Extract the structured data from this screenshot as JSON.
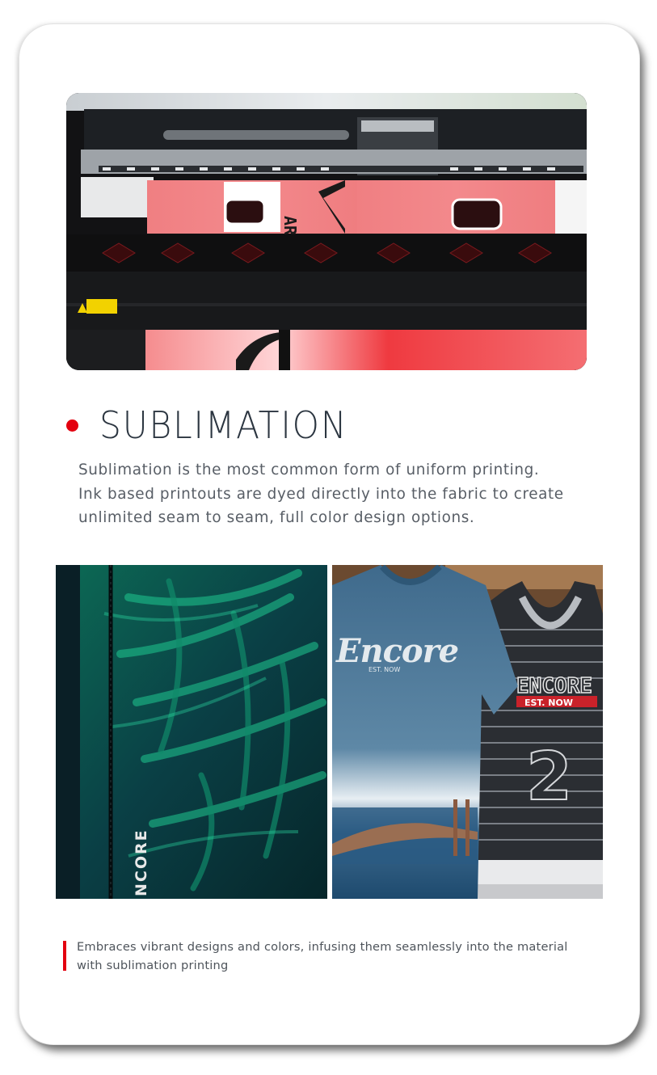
{
  "section": {
    "title": "SUBLIMATION",
    "description_lines": [
      "Sublimation is the most common form of uniform printing.",
      "Ink based printouts are dyed directly into the fabric to create",
      "unlimited seam to seam, full color design options."
    ]
  },
  "photos": {
    "hero_alt": "printer printing jerseys",
    "left_print_text": "NCORE",
    "right_tee_text": "Encore",
    "right_tee_subtext": "EST. NOW",
    "right_tank_text": "ENCORE",
    "right_tank_subtext": "EST. NOW",
    "right_tank_number": "2",
    "jersey_number": "2",
    "jersey_letters": "ARI"
  },
  "caption": {
    "lines": [
      "Embraces vibrant designs and colors, infusing them seamlessly into the material",
      "with sublimation printing"
    ]
  },
  "colors": {
    "accent": "#e3000f",
    "title": "#2c3641",
    "body_text": "#585e66"
  }
}
